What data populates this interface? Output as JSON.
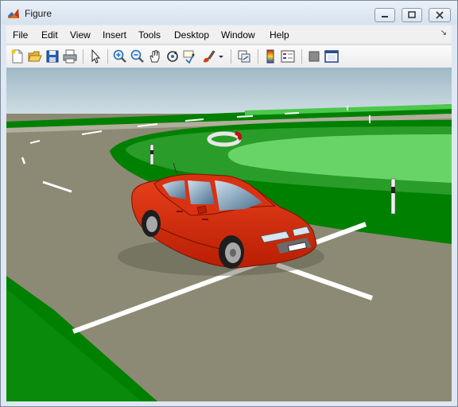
{
  "window": {
    "title": "Figure"
  },
  "menus": [
    "File",
    "Edit",
    "View",
    "Insert",
    "Tools",
    "Desktop",
    "Window",
    "Help"
  ],
  "toolbar": {
    "icons": [
      "new-figure-icon",
      "open-file-icon",
      "save-icon",
      "print-icon",
      "edit-plot-icon",
      "zoom-in-icon",
      "zoom-out-icon",
      "pan-icon",
      "rotate-3d-icon",
      "data-cursor-icon",
      "brush-icon",
      "link-plot-icon",
      "insert-colorbar-icon",
      "insert-legend-icon",
      "hide-plot-tools-icon",
      "show-plot-tools-icon"
    ]
  },
  "colors": {
    "sky_top": "#9eb9c6",
    "sky_horizon": "#d8e4e8",
    "grass_dark": "#008000",
    "grass_light": "#68d468",
    "road": "#8c8a74",
    "car": "#d42a08",
    "line": "#ffffff"
  }
}
